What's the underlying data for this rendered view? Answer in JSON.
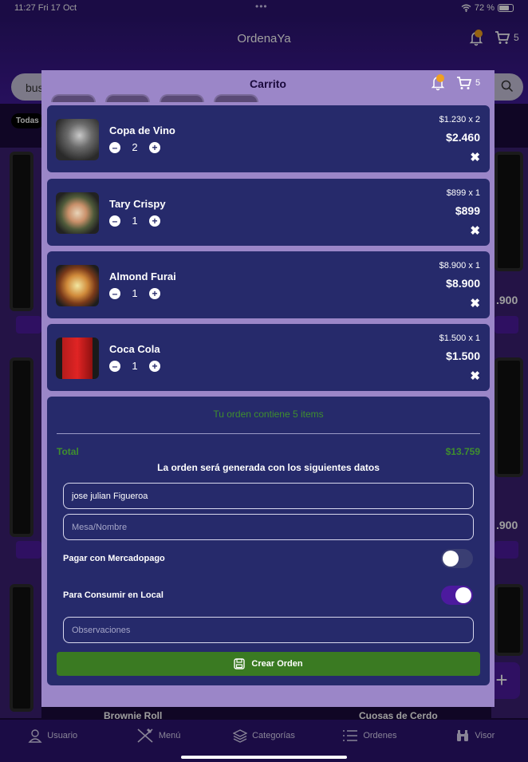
{
  "status_bar": {
    "time": "11:27  Fri 17 Oct",
    "dots": "•••",
    "battery": "72 %"
  },
  "header": {
    "app_title": "OrdenaYa",
    "notification_count": "1",
    "cart_count": "5"
  },
  "search": {
    "placeholder": "buscar..."
  },
  "categories": {
    "selected": "Todas"
  },
  "background_cards": {
    "price_partial_1": ".900",
    "price_partial_2": ".900",
    "bottom_label_left": "Brownie Roll",
    "bottom_label_right": "Cuosas de Cerdo"
  },
  "cart": {
    "title": "Carrito",
    "notification_count": "1",
    "cart_count": "5",
    "items": [
      {
        "name": "Copa de Vino",
        "qty": "2",
        "unit_price": "$1.230 x 2",
        "subtotal": "$2.460",
        "thumb_icon": "wine-glass-photo"
      },
      {
        "name": "Tary Crispy",
        "qty": "1",
        "unit_price": "$899 x 1",
        "subtotal": "$899",
        "thumb_icon": "sushi-roll-photo"
      },
      {
        "name": "Almond Furai",
        "qty": "1",
        "unit_price": "$8.900 x 1",
        "subtotal": "$8.900",
        "thumb_icon": "fried-sushi-photo"
      },
      {
        "name": "Coca Cola",
        "qty": "1",
        "unit_price": "$1.500 x 1",
        "subtotal": "$1.500",
        "thumb_icon": "coca-cola-can-photo"
      }
    ],
    "summary": {
      "count_text": "Tu orden contiene 5 items",
      "total_label": "Total",
      "total_value": "$13.759",
      "generation_text": "La orden será generada con los siguientes datos"
    },
    "form": {
      "name_value": "jose julian Figueroa",
      "mesa_placeholder": "Mesa/Nombre",
      "mercadopago_label": "Pagar con Mercadopago",
      "mercadopago_on": false,
      "local_label": "Para Consumir en Local",
      "local_on": true,
      "observations_placeholder": "Observaciones",
      "create_button": "Crear Orden"
    }
  },
  "tab_bar": {
    "tabs": [
      {
        "label": "Usuario",
        "icon": "user-icon"
      },
      {
        "label": "Menú",
        "icon": "utensils-icon"
      },
      {
        "label": "Categorías",
        "icon": "layers-icon"
      },
      {
        "label": "Ordenes",
        "icon": "list-icon"
      },
      {
        "label": "Visor",
        "icon": "binoculars-icon"
      }
    ]
  },
  "colors": {
    "header_purple": "#3f1a96",
    "modal_bg": "#9b86c8",
    "card_navy": "#262a6b",
    "accent_green": "#3f8e2e",
    "button_green": "#3a7a22",
    "toggle_on": "#4c1a9e",
    "badge_orange": "#f0a020"
  }
}
